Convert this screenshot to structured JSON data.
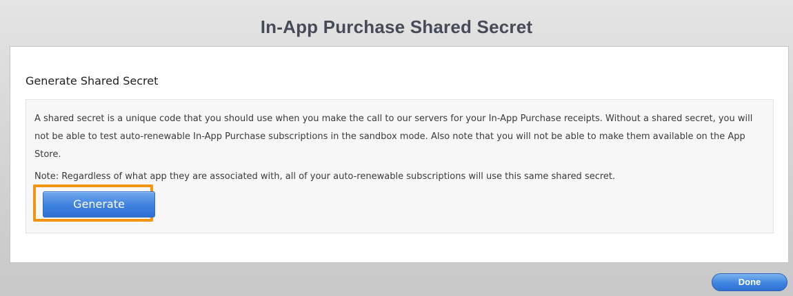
{
  "dialog": {
    "title": "In-App Purchase Shared Secret"
  },
  "section": {
    "heading": "Generate Shared Secret",
    "description": "A shared secret is a unique code that you should use when you make the call to our servers for your In-App Purchase receipts. Without a shared secret, you will not be able to test auto-renewable In-App Purchase subscriptions in the sandbox mode. Also note that you will not be able to make them available on the App Store.",
    "note": "Note: Regardless of what app they are associated with, all of your auto-renewable subscriptions will use this same shared secret.",
    "generate_label": "Generate"
  },
  "footer": {
    "done_label": "Done"
  },
  "colors": {
    "highlight": "#f39314",
    "button_blue": "#3d81de",
    "title_text": "#454c57"
  }
}
